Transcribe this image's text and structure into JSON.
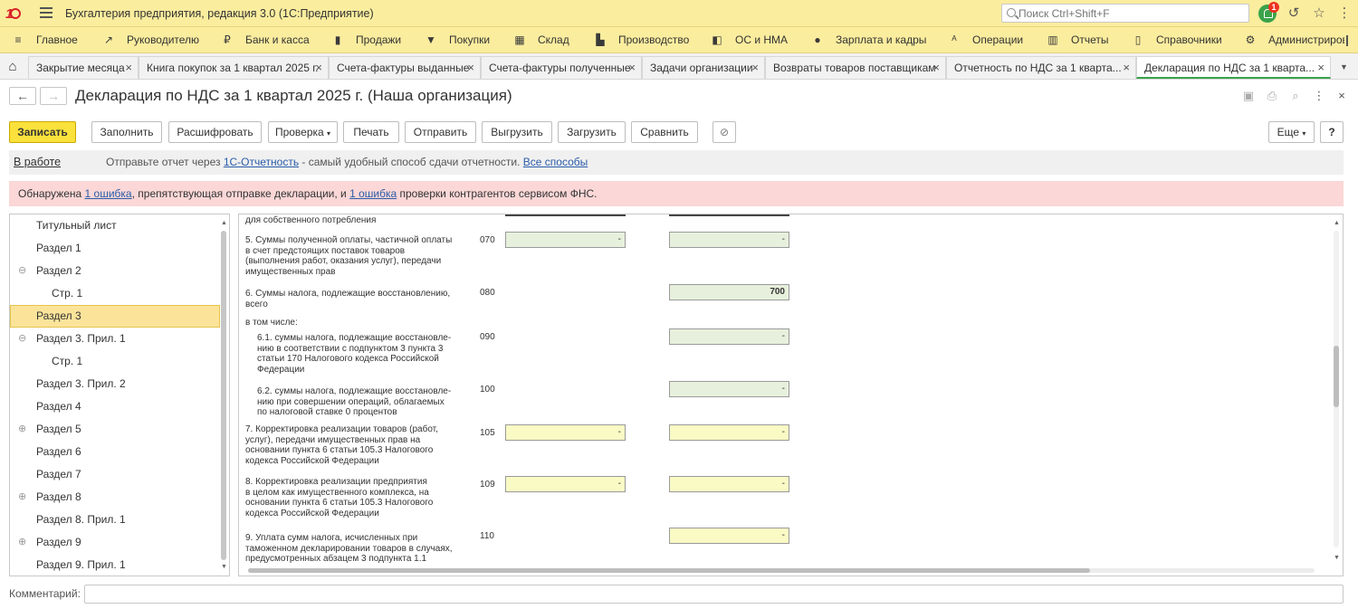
{
  "app": {
    "title": "Бухгалтерия предприятия, редакция 3.0  (1С:Предприятие)",
    "search_placeholder": "Поиск Ctrl+Shift+F",
    "notifications_count": "1"
  },
  "sections": [
    {
      "label": "Главное",
      "icon": "≡"
    },
    {
      "label": "Руководителю",
      "icon": "↗"
    },
    {
      "label": "Банк и касса",
      "icon": "₽"
    },
    {
      "label": "Продажи",
      "icon": "▮"
    },
    {
      "label": "Покупки",
      "icon": "▼"
    },
    {
      "label": "Склад",
      "icon": "▦"
    },
    {
      "label": "Производство",
      "icon": "▙"
    },
    {
      "label": "ОС и НМА",
      "icon": "◧"
    },
    {
      "label": "Зарплата и кадры",
      "icon": "●"
    },
    {
      "label": "Операции",
      "icon": "ᴬ"
    },
    {
      "label": "Отчеты",
      "icon": "▥"
    },
    {
      "label": "Справочники",
      "icon": "▯"
    },
    {
      "label": "Администрирование",
      "icon": "⚙"
    }
  ],
  "tabs": [
    {
      "label": "Закрытие месяца"
    },
    {
      "label": "Книга покупок за 1 квартал 2025 г."
    },
    {
      "label": "Счета-фактуры выданные"
    },
    {
      "label": "Счета-фактуры полученные"
    },
    {
      "label": "Задачи организации"
    },
    {
      "label": "Возвраты товаров поставщикам"
    },
    {
      "label": "Отчетность по НДС за 1 кварта..."
    },
    {
      "label": "Декларация по НДС за 1 кварта..."
    }
  ],
  "form": {
    "title": "Декларация по НДС за 1 квартал 2025 г. (Наша организация)"
  },
  "toolbar": {
    "save": "Записать",
    "fill": "Заполнить",
    "decode": "Расшифровать",
    "check": "Проверка",
    "print": "Печать",
    "send": "Отправить",
    "export": "Выгрузить",
    "import": "Загрузить",
    "compare": "Сравнить",
    "more": "Еще",
    "help": "?"
  },
  "status": {
    "state": "В работе",
    "text_before": "Отправьте отчет через ",
    "link1": "1С-Отчетность",
    "text_middle": " - самый удобный способ сдачи отчетности. ",
    "link2": "Все способы"
  },
  "error": {
    "p1": "Обнаружена ",
    "link1": "1 ошибка",
    "p2": ", препятствующая отправке декларации, и ",
    "link2": "1 ошибка",
    "p3": " проверки контрагентов сервисом ФНС."
  },
  "tree": [
    {
      "label": "Титульный лист"
    },
    {
      "label": "Раздел 1"
    },
    {
      "label": "Раздел 2",
      "toggle": "⊖"
    },
    {
      "label": "Стр. 1"
    },
    {
      "label": "Раздел 3"
    },
    {
      "label": "Раздел 3. Прил. 1",
      "toggle": "⊖"
    },
    {
      "label": "Стр. 1"
    },
    {
      "label": "Раздел 3. Прил. 2"
    },
    {
      "label": "Раздел 4"
    },
    {
      "label": "Раздел 5",
      "toggle": "⊕"
    },
    {
      "label": "Раздел 6"
    },
    {
      "label": "Раздел 7"
    },
    {
      "label": "Раздел 8",
      "toggle": "⊕"
    },
    {
      "label": "Раздел 8. Прил. 1"
    },
    {
      "label": "Раздел 9",
      "toggle": "⊕"
    },
    {
      "label": "Раздел 9. Прил. 1"
    }
  ],
  "rows": [
    {
      "text": [
        "для собственного потребления"
      ]
    },
    {
      "text": [
        "5. Суммы полученной оплаты, частичной оплаты",
        "в счет предстоящих поставок товаров",
        "(выполнения работ, оказания услуг), передачи",
        "имущественных прав"
      ],
      "code": "070",
      "v1": "-",
      "v2": "-"
    },
    {
      "text": [
        "6. Суммы налога, подлежащие восстановлению,",
        "всего"
      ],
      "code": "080",
      "v2": "700"
    },
    {
      "text": [
        "в том числе:"
      ]
    },
    {
      "text": [
        "6.1. суммы налога, подлежащие восстановле-",
        "нию в соответствии с подпунктом 3 пункта 3",
        "статьи 170 Налогового кодекса Российской",
        "Федерации"
      ],
      "code": "090",
      "v2": "-"
    },
    {
      "text": [
        "6.2. суммы налога, подлежащие восстановле-",
        "нию при совершении операций, облагаемых",
        "по налоговой ставке 0 процентов"
      ],
      "code": "100",
      "v2": "-"
    },
    {
      "text": [
        "7. Корректировка реализации товаров (работ,",
        "услуг), передачи имущественных прав на",
        "основании пункта 6 статьи 105.3 Налогового",
        "кодекса Российской Федерации"
      ],
      "code": "105",
      "v1": "-",
      "v2": "-"
    },
    {
      "text": [
        "8. Корректировка реализации предприятия",
        "в целом как имущественного комплекса, на",
        "основании пункта 6 статьи 105.3 Налогового",
        "кодекса Российской Федерации"
      ],
      "code": "109",
      "v1": "-",
      "v2": "-"
    },
    {
      "text": [
        "9. Уплата сумм налога, исчисленных при",
        "таможенном декларировании товаров в случаях,",
        "предусмотренных абзацем 3 подпункта 1.1"
      ],
      "code": "110",
      "v2": "-"
    }
  ],
  "comment": {
    "label": "Комментарий:",
    "value": ""
  }
}
